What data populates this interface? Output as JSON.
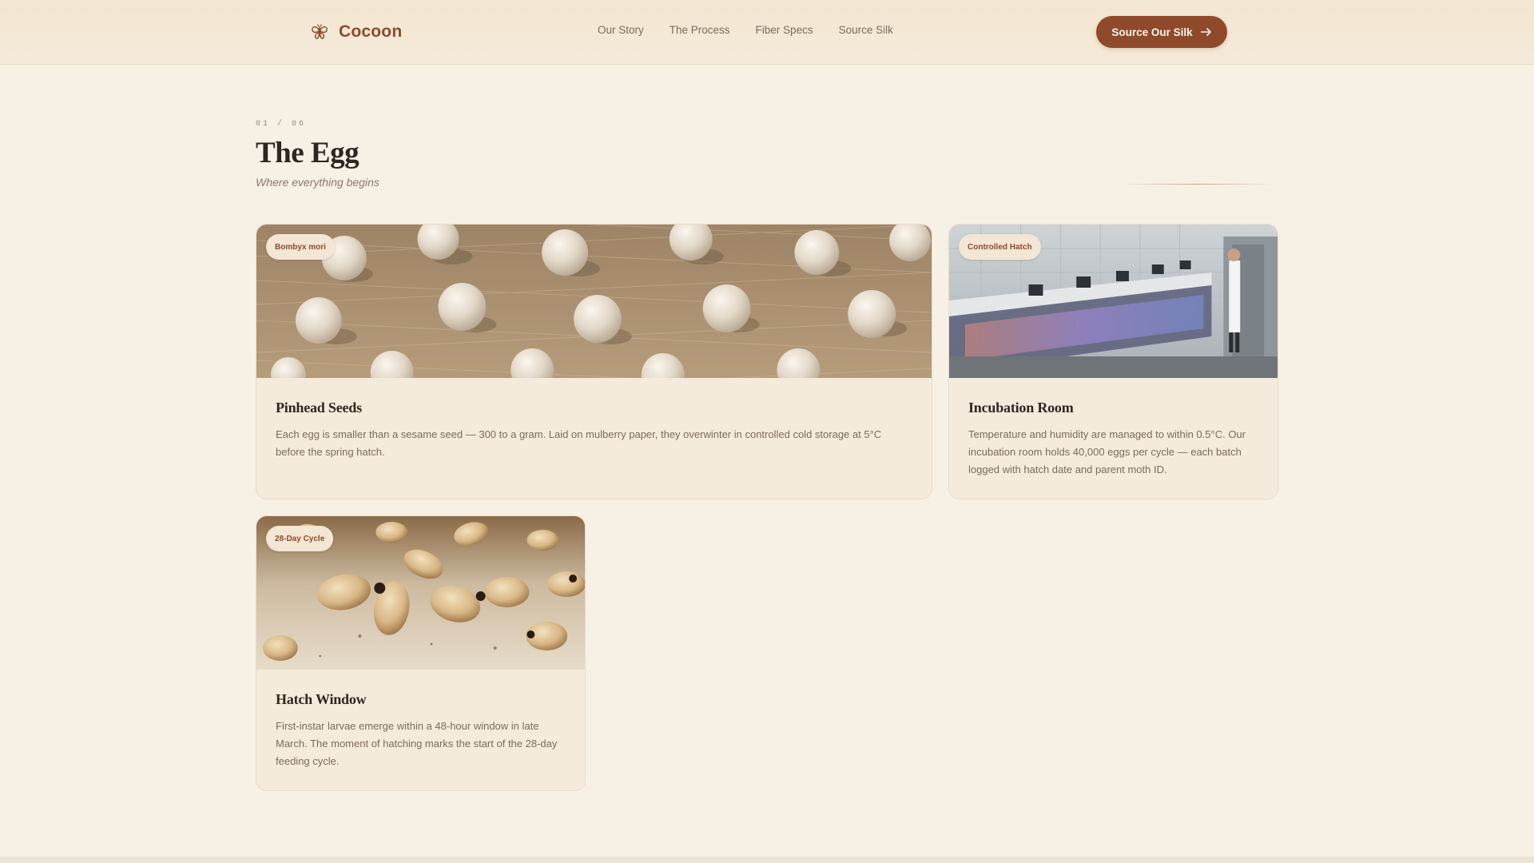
{
  "header": {
    "brand": "Cocoon",
    "nav": [
      "Our Story",
      "The Process",
      "Fiber Specs",
      "Source Silk"
    ],
    "cta_label": "Source Our Silk",
    "cta_icon": "arrow-right-icon",
    "brand_icon": "moth-icon"
  },
  "section": {
    "step": "01 / 06",
    "title": "The Egg",
    "subtitle": "Where everything begins"
  },
  "cards": [
    {
      "badge": "Bombyx mori",
      "title": "Pinhead Seeds",
      "body": "Each egg is smaller than a sesame seed — 300 to a gram. Laid on mulberry paper, they overwinter in controlled cold storage at 5°C before the spring hatch.",
      "image": "silkworm-eggs-photo"
    },
    {
      "badge": "Controlled Hatch",
      "title": "Incubation Room",
      "body": "Temperature and humidity are managed to within 0.5°C. Our incubation room holds 40,000 eggs per cycle — each batch logged with hatch date and parent moth ID.",
      "image": "incubation-lab-photo"
    },
    {
      "badge": "28-Day Cycle",
      "title": "Hatch Window",
      "body": "First-instar larvae emerge within a 48-hour window in late March. The moment of hatching marks the start of the 28-day feeding cycle.",
      "image": "larvae-photo"
    }
  ],
  "colors": {
    "accent": "#8e4a2a",
    "background": "#f7f0e5",
    "card": "#f5ebdc"
  }
}
